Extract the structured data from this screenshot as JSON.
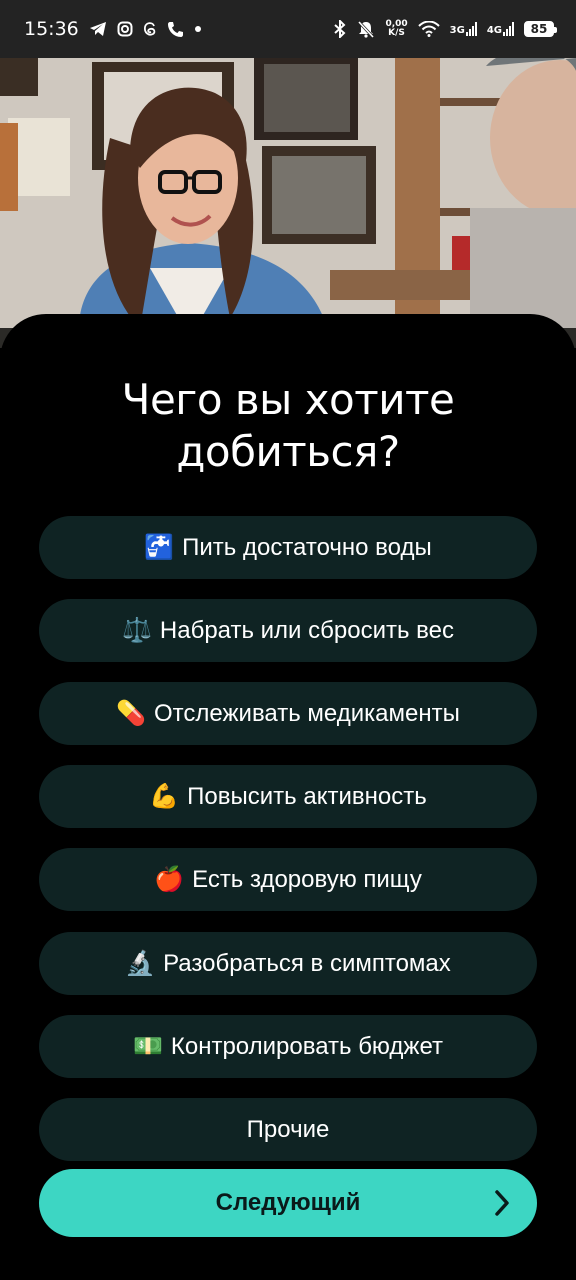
{
  "status_bar": {
    "time": "15:36",
    "speed_value": "0,00",
    "speed_unit": "K/S",
    "net1": "3G",
    "net2": "4G",
    "battery": "85",
    "left_icons": [
      "telegram-icon",
      "instagram-icon",
      "threads-icon",
      "phone-icon",
      "dot-icon"
    ],
    "right_icons": [
      "bluetooth-icon",
      "mute-icon",
      "wifi-icon",
      "signal-icon",
      "battery-icon"
    ]
  },
  "hero": {
    "image": "woman-smiling-cafe-photo"
  },
  "title": "Чего вы хотите добиться?",
  "options": [
    {
      "emoji": "🚰",
      "label": "Пить достаточно воды"
    },
    {
      "emoji": "⚖️",
      "label": "Набрать или сбросить вес"
    },
    {
      "emoji": "💊",
      "label": "Отслеживать медикаменты"
    },
    {
      "emoji": "💪",
      "label": "Повысить активность"
    },
    {
      "emoji": "🍎",
      "label": "Есть здоровую пищу"
    },
    {
      "emoji": "🔬",
      "label": "Разобраться в симптомах"
    },
    {
      "emoji": "💵",
      "label": "Контролировать бюджет"
    },
    {
      "emoji": "",
      "label": "Прочие"
    }
  ],
  "next_button": {
    "label": "Следующий",
    "icon": "chevron-right-icon"
  },
  "colors": {
    "accent": "#3dd6c3",
    "option_bg": "#0f2323",
    "background": "#000000",
    "status_bar_bg": "#232323"
  }
}
